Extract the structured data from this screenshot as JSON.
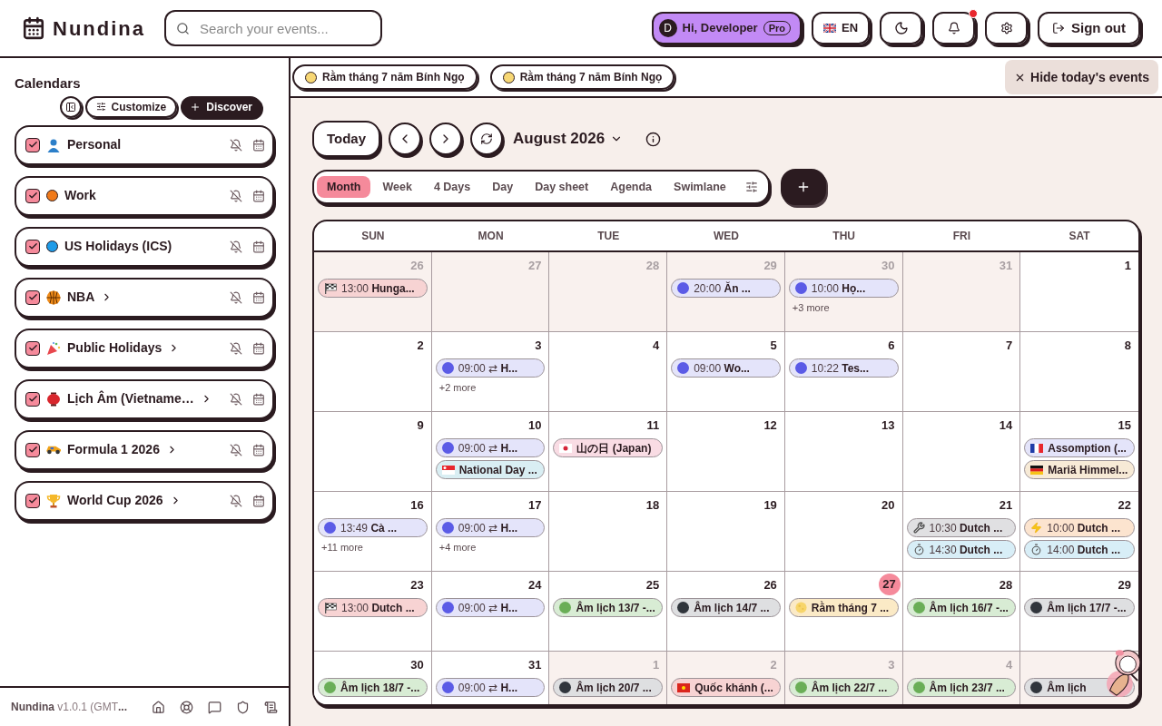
{
  "app": {
    "name": "Nundina"
  },
  "search": {
    "placeholder": "Search your events..."
  },
  "user": {
    "initial": "D",
    "greeting": "Hi, Developer",
    "badge": "Pro"
  },
  "language": {
    "label": "EN"
  },
  "notifications": {
    "unread": true
  },
  "sign_out": {
    "label": "Sign out"
  },
  "sidebar": {
    "title": "Calendars",
    "buttons": [
      {
        "kind": "collapse"
      },
      {
        "kind": "customize",
        "label": "Customize"
      },
      {
        "kind": "discover",
        "label": "Discover"
      }
    ],
    "calendars": [
      {
        "name": "Personal",
        "kind": "person",
        "checked": true,
        "expandable": false
      },
      {
        "name": "Work",
        "kind": "dot",
        "color": "#f07a1a",
        "checked": true,
        "expandable": false
      },
      {
        "name": "US Holidays (ICS)",
        "kind": "dot",
        "color": "#1e9be8",
        "checked": true,
        "expandable": false
      },
      {
        "name": "NBA",
        "kind": "ball",
        "checked": true,
        "expandable": true
      },
      {
        "name": "Public Holidays",
        "kind": "party",
        "checked": true,
        "expandable": true
      },
      {
        "name": "Lịch Âm (Vietname…",
        "kind": "lantern",
        "checked": true,
        "expandable": true
      },
      {
        "name": "Formula 1 2026",
        "kind": "car",
        "checked": true,
        "expandable": true
      },
      {
        "name": "World Cup 2026",
        "kind": "trophy",
        "checked": true,
        "expandable": true
      }
    ],
    "footer": {
      "app": "Nundina",
      "version": "v1.0.1 (GMT",
      "ellipsis": "..."
    }
  },
  "today_events": {
    "chips": [
      "Rằm tháng 7 năm Bính Ngọ",
      "Rằm tháng 7 năm Bính Ngọ"
    ],
    "hide": "Hide today's events"
  },
  "toolbar": {
    "today": "Today",
    "month": "August 2026",
    "views": [
      {
        "label": "Month",
        "selected": true
      },
      {
        "label": "Week",
        "selected": false
      },
      {
        "label": "4 Days",
        "selected": false
      },
      {
        "label": "Day",
        "selected": false
      },
      {
        "label": "Day sheet",
        "selected": false
      },
      {
        "label": "Agenda",
        "selected": false
      },
      {
        "label": "Swimlane",
        "selected": false
      }
    ]
  },
  "calendar": {
    "weekdays": [
      "SUN",
      "MON",
      "TUE",
      "WED",
      "THU",
      "FRI",
      "SAT"
    ],
    "weeks": [
      [
        {
          "day": "26",
          "muted": true,
          "today": false,
          "events": [
            {
              "kind": "checkered",
              "color": "#f7d3d3",
              "time": "13:00",
              "title": "Hunga..."
            }
          ]
        },
        {
          "day": "27",
          "muted": true,
          "today": false
        },
        {
          "day": "28",
          "muted": true,
          "today": false
        },
        {
          "day": "29",
          "muted": true,
          "today": false,
          "events": [
            {
              "kind": "dot",
              "color": "#e4e4fa",
              "time": "20:00",
              "title": "Ăn ..."
            }
          ]
        },
        {
          "day": "30",
          "muted": true,
          "today": false,
          "events": [
            {
              "kind": "dot",
              "color": "#e4e4fa",
              "time": "10:00",
              "title": "Họ..."
            }
          ],
          "more": "+3 more"
        },
        {
          "day": "31",
          "muted": true,
          "today": false
        },
        {
          "day": "1",
          "muted": false,
          "today": false
        }
      ],
      [
        {
          "day": "2",
          "muted": false,
          "today": false
        },
        {
          "day": "3",
          "muted": false,
          "today": false,
          "events": [
            {
              "kind": "dot",
              "color": "#e4e4fa",
              "time": "09:00 ⇄",
              "title": "H..."
            }
          ],
          "more": "+2 more"
        },
        {
          "day": "4",
          "muted": false,
          "today": false
        },
        {
          "day": "5",
          "muted": false,
          "today": false,
          "events": [
            {
              "kind": "dot",
              "color": "#e4e4fa",
              "time": "09:00",
              "title": "Wo..."
            }
          ]
        },
        {
          "day": "6",
          "muted": false,
          "today": false,
          "events": [
            {
              "kind": "dot",
              "color": "#e4e4fa",
              "time": "10:22",
              "title": "Tes..."
            }
          ]
        },
        {
          "day": "7",
          "muted": false,
          "today": false
        },
        {
          "day": "8",
          "muted": false,
          "today": false
        }
      ],
      [
        {
          "day": "9",
          "muted": false,
          "today": false
        },
        {
          "day": "10",
          "muted": false,
          "today": false,
          "events": [
            {
              "kind": "dot",
              "color": "#e4e4fa",
              "time": "09:00 ⇄",
              "title": "H..."
            },
            {
              "kind": "flag-sg",
              "color": "#d9eef3",
              "title": "National Day ..."
            }
          ]
        },
        {
          "day": "11",
          "muted": false,
          "today": false,
          "events": [
            {
              "kind": "flag-jp",
              "color": "#f9dce4",
              "title": "山の日 (Japan)"
            }
          ]
        },
        {
          "day": "12",
          "muted": false,
          "today": false
        },
        {
          "day": "13",
          "muted": false,
          "today": false
        },
        {
          "day": "14",
          "muted": false,
          "today": false
        },
        {
          "day": "15",
          "muted": false,
          "today": false,
          "events": [
            {
              "kind": "flag-fr",
              "color": "#e4e4fa",
              "title": "Assomption (..."
            },
            {
              "kind": "flag-de",
              "color": "#f7ead6",
              "title": "Mariä Himmel..."
            }
          ]
        }
      ],
      [
        {
          "day": "16",
          "muted": false,
          "today": false,
          "events": [
            {
              "kind": "dot",
              "color": "#e4e4fa",
              "time": "13:49",
              "title": "Cà ..."
            }
          ],
          "more": "+11 more"
        },
        {
          "day": "17",
          "muted": false,
          "today": false,
          "events": [
            {
              "kind": "dot",
              "color": "#e4e4fa",
              "time": "09:00 ⇄",
              "title": "H..."
            }
          ],
          "more": "+4 more"
        },
        {
          "day": "18",
          "muted": false,
          "today": false
        },
        {
          "day": "19",
          "muted": false,
          "today": false
        },
        {
          "day": "20",
          "muted": false,
          "today": false
        },
        {
          "day": "21",
          "muted": false,
          "today": false,
          "events": [
            {
              "kind": "wrench",
              "color": "#e0e0e2",
              "time": "10:30",
              "title": "Dutch ..."
            },
            {
              "kind": "stopwatch",
              "color": "#d8eef7",
              "time": "14:30",
              "title": "Dutch ..."
            }
          ]
        },
        {
          "day": "22",
          "muted": false,
          "today": false,
          "events": [
            {
              "kind": "bolt",
              "color": "#fce4cf",
              "time": "10:00",
              "title": "Dutch ..."
            },
            {
              "kind": "stopwatch",
              "color": "#d8eef7",
              "time": "14:00",
              "title": "Dutch ..."
            }
          ]
        }
      ],
      [
        {
          "day": "23",
          "muted": false,
          "today": false,
          "events": [
            {
              "kind": "checkered",
              "color": "#f7d3d3",
              "time": "13:00",
              "title": "Dutch ..."
            }
          ]
        },
        {
          "day": "24",
          "muted": false,
          "today": false,
          "events": [
            {
              "kind": "dot",
              "color": "#e4e4fa",
              "time": "09:00 ⇄",
              "title": "H..."
            }
          ]
        },
        {
          "day": "25",
          "muted": false,
          "today": false,
          "events": [
            {
              "kind": "dot",
              "color": "#d8ecd4",
              "title": "Âm lịch 13/7 -..."
            }
          ]
        },
        {
          "day": "26",
          "muted": false,
          "today": false,
          "events": [
            {
              "kind": "dot",
              "color": "#dedfe1",
              "title": "Âm lịch 14/7 ..."
            }
          ]
        },
        {
          "day": "27",
          "muted": false,
          "today": true,
          "events": [
            {
              "kind": "moon",
              "color": "#fbeac6",
              "title": "Rằm tháng 7 ..."
            }
          ]
        },
        {
          "day": "28",
          "muted": false,
          "today": false,
          "events": [
            {
              "kind": "dot",
              "color": "#d8ecd4",
              "title": "Âm lịch 16/7 -..."
            }
          ]
        },
        {
          "day": "29",
          "muted": false,
          "today": false,
          "events": [
            {
              "kind": "dot",
              "color": "#dedfe1",
              "title": "Âm lịch 17/7 -..."
            }
          ]
        }
      ],
      [
        {
          "day": "30",
          "muted": false,
          "today": false,
          "events": [
            {
              "kind": "dot",
              "color": "#d8ecd4",
              "title": "Âm lịch 18/7 -..."
            }
          ]
        },
        {
          "day": "31",
          "muted": false,
          "today": false,
          "events": [
            {
              "kind": "dot",
              "color": "#e4e4fa",
              "time": "09:00 ⇄",
              "title": "H..."
            }
          ]
        },
        {
          "day": "1",
          "muted": true,
          "today": false,
          "events": [
            {
              "kind": "dot",
              "color": "#dedfe1",
              "title": "Âm lịch 20/7 ..."
            }
          ]
        },
        {
          "day": "2",
          "muted": true,
          "today": false,
          "events": [
            {
              "kind": "flag-vn",
              "color": "#f7d3d3",
              "title": "Quốc khánh (..."
            }
          ]
        },
        {
          "day": "3",
          "muted": true,
          "today": false,
          "events": [
            {
              "kind": "dot",
              "color": "#d8ecd4",
              "title": "Âm lịch 22/7 ..."
            }
          ]
        },
        {
          "day": "4",
          "muted": true,
          "today": false,
          "events": [
            {
              "kind": "dot",
              "color": "#d8ecd4",
              "title": "Âm lịch 23/7 ..."
            }
          ]
        },
        {
          "muted": true,
          "today": false,
          "events": [
            {
              "kind": "dot",
              "color": "#dedfe1",
              "title": "Âm lịch"
            }
          ]
        }
      ]
    ]
  }
}
